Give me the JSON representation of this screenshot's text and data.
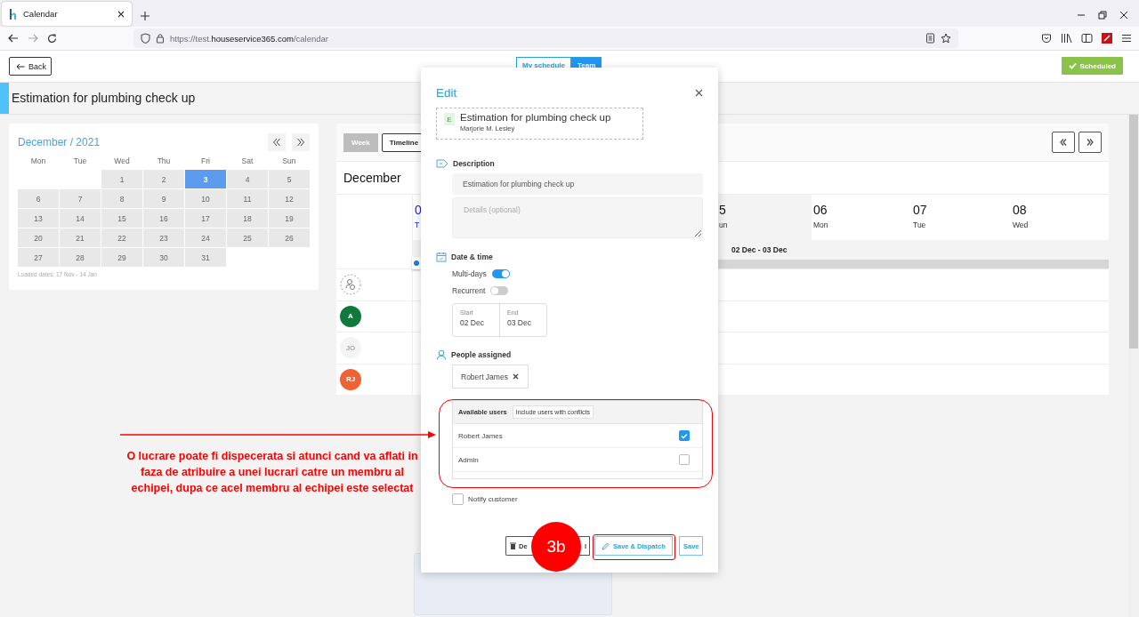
{
  "browser": {
    "tab_title": "Calendar",
    "url": {
      "scheme": "https://test.",
      "domain": "houseservice365.com",
      "path": "/calendar"
    }
  },
  "header": {
    "back_label": "Back",
    "view_tabs": [
      {
        "label": "My schedule",
        "selected": false
      },
      {
        "label": "Team",
        "selected": true
      }
    ],
    "status": "Scheduled"
  },
  "job_title": "Estimation for plumbing check up",
  "mini_calendar": {
    "title": "December / 2021",
    "weekdays": [
      "Mon",
      "Tue",
      "Wed",
      "Thu",
      "Fri",
      "Sat",
      "Sun"
    ],
    "weeks": [
      [
        {
          "label": "1",
          "selected": false
        },
        {
          "label": "2",
          "selected": false
        },
        {
          "label": "3",
          "selected": true
        },
        {
          "label": "4",
          "selected": false
        },
        {
          "label": "5",
          "selected": false
        }
      ],
      [
        {
          "label": "6",
          "selected": false
        },
        {
          "label": "7",
          "selected": false
        },
        {
          "label": "8",
          "selected": false
        },
        {
          "label": "9",
          "selected": false
        },
        {
          "label": "10",
          "selected": false
        },
        {
          "label": "11",
          "selected": false
        },
        {
          "label": "12",
          "selected": false
        }
      ],
      [
        {
          "label": "13",
          "selected": false
        },
        {
          "label": "14",
          "selected": false
        },
        {
          "label": "15",
          "selected": false
        },
        {
          "label": "16",
          "selected": false
        },
        {
          "label": "17",
          "selected": false
        },
        {
          "label": "18",
          "selected": false
        },
        {
          "label": "19",
          "selected": false
        }
      ],
      [
        {
          "label": "20",
          "selected": false
        },
        {
          "label": "21",
          "selected": false
        },
        {
          "label": "22",
          "selected": false
        },
        {
          "label": "23",
          "selected": false
        },
        {
          "label": "24",
          "selected": false
        },
        {
          "label": "25",
          "selected": false
        },
        {
          "label": "26",
          "selected": false
        }
      ],
      [
        {
          "label": "27",
          "selected": false
        },
        {
          "label": "28",
          "selected": false
        },
        {
          "label": "29",
          "selected": false
        },
        {
          "label": "30",
          "selected": false
        },
        {
          "label": "31",
          "selected": false
        }
      ]
    ],
    "footer": "Loaded dates: 17 Nov - 14 Jan"
  },
  "timeline": {
    "view_modes": [
      {
        "label": "Week",
        "selected": false
      },
      {
        "label": "Timeline",
        "selected": true
      }
    ],
    "month": "December",
    "days": [
      {
        "number": "0",
        "weekday": "T",
        "today": true,
        "weekend": false
      },
      {
        "number": "5",
        "weekday": "un",
        "today": false,
        "weekend": true
      },
      {
        "number": "06",
        "weekday": "Mon",
        "today": false,
        "weekend": false
      },
      {
        "number": "07",
        "weekday": "Tue",
        "today": false,
        "weekend": false
      },
      {
        "number": "08",
        "weekday": "Wed",
        "today": false,
        "weekend": false
      }
    ],
    "range_label": "02 Dec - 03 Dec",
    "rows": [
      {
        "kind": "unassigned"
      },
      {
        "kind": "person",
        "initials": "A",
        "color": "#0f7a3c",
        "faded": false
      },
      {
        "kind": "person",
        "initials": "JO",
        "color": "#f4f4f4",
        "faded": true
      },
      {
        "kind": "person",
        "initials": "RJ",
        "color": "#ee6233",
        "faded": false
      }
    ]
  },
  "modal": {
    "title": "Edit",
    "job": {
      "badge": "E",
      "title": "Estimation for plumbing check up",
      "customer": "Marjorie M. Lesley"
    },
    "description": {
      "label": "Description",
      "value": "Estimation for plumbing check up",
      "details_placeholder": "Details (optional)"
    },
    "date_time": {
      "label": "Date & time",
      "toggles": [
        {
          "label": "Multi-days",
          "on": true
        },
        {
          "label": "Recurrent",
          "on": false
        }
      ],
      "start": {
        "label": "Start",
        "value": "02 Dec"
      },
      "end": {
        "label": "End",
        "value": "03 Dec"
      }
    },
    "people": {
      "label": "People assigned",
      "assigned": [
        "Robert James"
      ],
      "available_label": "Available users",
      "conflicts_button": "Include users with conflicts",
      "users": [
        {
          "name": "Robert James",
          "checked": true
        },
        {
          "name": "Admin",
          "checked": false
        }
      ]
    },
    "notify": {
      "label": "Notify customer",
      "checked": false
    },
    "buttons": [
      {
        "label": "De",
        "kind": "delete"
      },
      {
        "label": "l",
        "kind": "cancel"
      },
      {
        "label": "Save & Dispatch",
        "kind": "dispatch"
      },
      {
        "label": "Save",
        "kind": "save"
      }
    ]
  },
  "annotation": {
    "text": "O lucrare poate fi dispecerata si atunci cand va aflati in faza de atribuire a unei lucrari catre un membru al echipei, dupa ce acel membru al echipei este selectat",
    "step": "3b"
  }
}
